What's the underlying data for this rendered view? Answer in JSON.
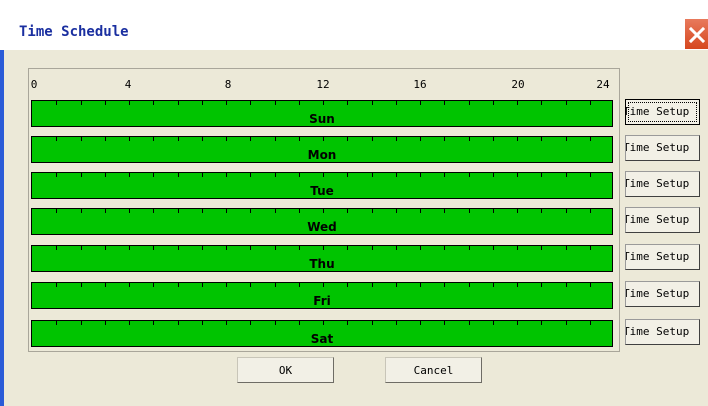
{
  "window": {
    "title": "Time Schedule",
    "close_icon": "close-icon"
  },
  "colors": {
    "bar_fill": "#00c400",
    "title_text": "#1a2fa0",
    "close_button": "#d6471f"
  },
  "timeline": {
    "hour_labels": [
      "0",
      "4",
      "8",
      "12",
      "16",
      "20",
      "24"
    ]
  },
  "days": [
    {
      "label": "Sun",
      "setup_label": "Time Setup",
      "schedule": "full day (0-24)"
    },
    {
      "label": "Mon",
      "setup_label": "Time Setup",
      "schedule": "full day (0-24)"
    },
    {
      "label": "Tue",
      "setup_label": "Time Setup",
      "schedule": "full day (0-24)"
    },
    {
      "label": "Wed",
      "setup_label": "Time Setup",
      "schedule": "full day (0-24)"
    },
    {
      "label": "Thu",
      "setup_label": "Time Setup",
      "schedule": "full day (0-24)"
    },
    {
      "label": "Fri",
      "setup_label": "Time Setup",
      "schedule": "full day (0-24)"
    },
    {
      "label": "Sat",
      "setup_label": "Time Setup",
      "schedule": "full day (0-24)"
    }
  ],
  "buttons": {
    "ok": "OK",
    "cancel": "Cancel"
  }
}
